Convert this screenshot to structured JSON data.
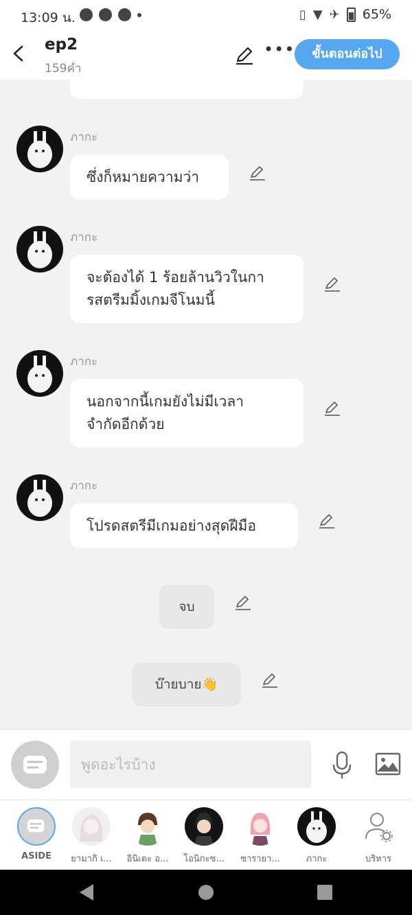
{
  "statusbar": {
    "time": "13:09 น.",
    "battery": "65%",
    "icons": [
      "chat-bubble-icon",
      "messenger-icon",
      "messenger-icon",
      "dot-icon",
      "vibrate-icon",
      "wifi-icon",
      "airplane-icon",
      "battery-icon"
    ]
  },
  "header": {
    "title": "ep2",
    "subtitle": "159คำ",
    "next_button": "ขั้นตอนต่อไป"
  },
  "messages": [
    {
      "sender": "ภากะ",
      "text": "ซึ่งก็หมายความว่า"
    },
    {
      "sender": "ภากะ",
      "line1": "จะต้องได้ 1 ร้อยล้านวิวในกา",
      "line2": "รสตรีมมิ้งเกมจีโนมนี้"
    },
    {
      "sender": "ภากะ",
      "line1": "นอกจากนี้เกมยังไม่มีเวลา",
      "line2": "จำกัดอีกด้วย"
    },
    {
      "sender": "ภากะ",
      "text": "โปรดสตรีมีเกมอย่างสุดฝีมือ"
    }
  ],
  "system_messages": [
    "จบ",
    "บ๊ายบาย👋"
  ],
  "input": {
    "placeholder": "พูดอะไรบ้าง"
  },
  "characters": [
    {
      "label": "ASIDE"
    },
    {
      "label": "ยามากิ เ..."
    },
    {
      "label": "อินิเตะ อ..."
    },
    {
      "label": "โอนิกะซ..."
    },
    {
      "label": "ซารายา..."
    },
    {
      "label": "ภากะ"
    },
    {
      "label": "บริหาร"
    }
  ],
  "colors": {
    "accent": "#55a7f0",
    "chat_bg": "#f2f2f2",
    "bubble": "#ffffff",
    "system_bubble": "#e8e8e8"
  }
}
